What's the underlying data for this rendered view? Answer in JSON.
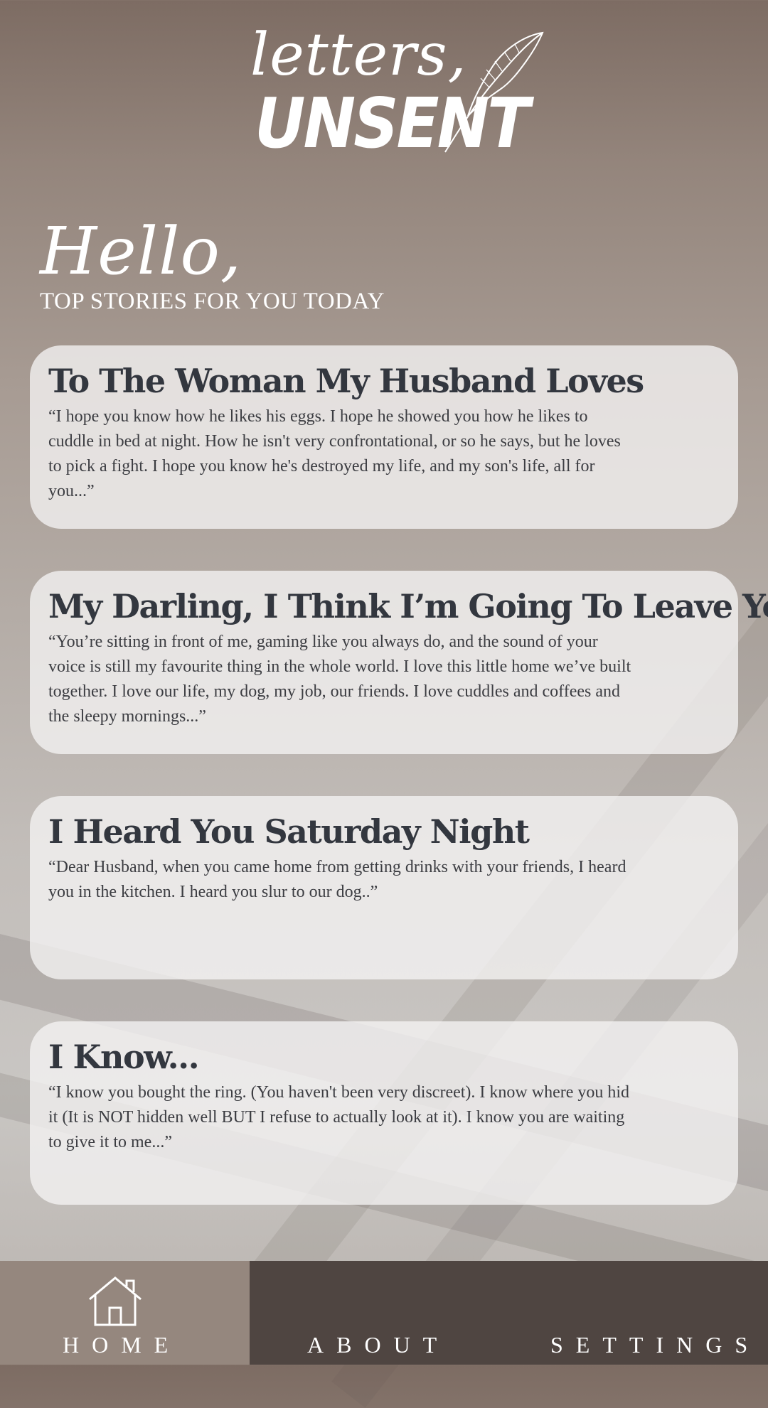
{
  "app": {
    "logo_script": "letters,",
    "logo_bold": "UNSENT"
  },
  "greeting": {
    "hello": "Hello,",
    "subtitle": "TOP STORIES FOR YOU TODAY"
  },
  "stories": [
    {
      "title": "To The Woman My Husband Loves",
      "excerpt": "“I hope you know how he likes his eggs. I hope he showed you how he likes to cuddle in bed at night. How he isn't very confrontational, or so he says, but he loves to pick a fight. I hope you know he's destroyed my life, and my son's life, all for you...”"
    },
    {
      "title": "My Darling, I Think I’m Going To Leave You",
      "excerpt": "“You’re sitting in front of me, gaming like you always do, and the sound of your voice is still my favourite thing in the whole world. I love this little home we’ve built together. I love our life, my dog, my job, our friends. I love cuddles and coffees and the sleepy mornings...”"
    },
    {
      "title": "I Heard You Saturday Night",
      "excerpt": "“Dear Husband, when you came home from getting drinks with your friends, I heard you in the kitchen. I heard you slur to our dog..”"
    },
    {
      "title": "I Know...",
      "excerpt": "“I know you bought the ring. (You haven't been very discreet). I know where you hid it (It is NOT hidden well BUT I refuse to actually look at it). I know you are waiting to give it to me...”"
    }
  ],
  "nav": {
    "home": "HOME",
    "about": "ABOUT",
    "settings": "SETTINGS",
    "home_icon": "house-icon"
  },
  "colors": {
    "card_title": "#33373f",
    "nav_active": "#95877e",
    "nav_inactive": "#4f4541"
  }
}
